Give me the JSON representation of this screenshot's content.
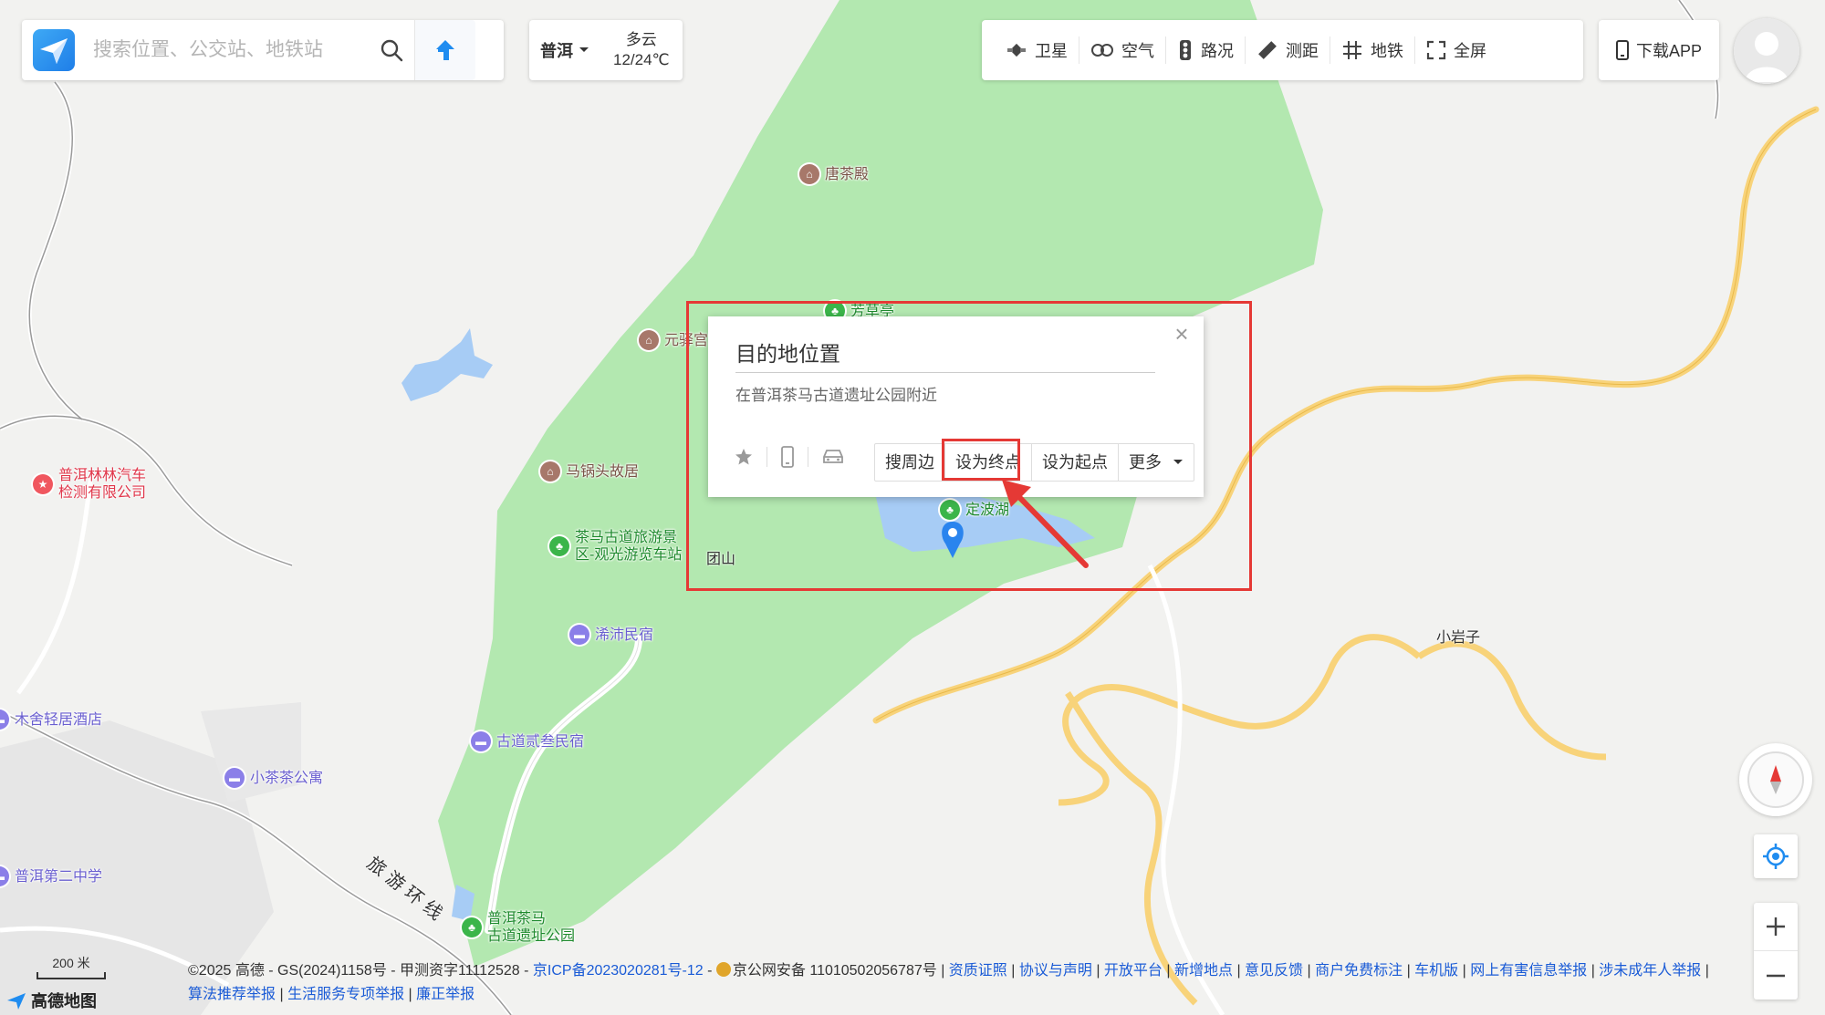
{
  "search": {
    "placeholder": "搜索位置、公交站、地铁站"
  },
  "weather": {
    "city": "普洱",
    "condition": "多云",
    "temp": "12/24℃"
  },
  "toolbar": {
    "items": [
      {
        "label": "卫星",
        "icon": "satellite-icon"
      },
      {
        "label": "空气",
        "icon": "air-icon"
      },
      {
        "label": "路况",
        "icon": "traffic-light-icon"
      },
      {
        "label": "测距",
        "icon": "ruler-icon"
      },
      {
        "label": "地铁",
        "icon": "subway-icon"
      },
      {
        "label": "全屏",
        "icon": "fullscreen-icon"
      }
    ]
  },
  "download": {
    "label": "下载APP"
  },
  "popup": {
    "title": "目的地位置",
    "address": "在普洱茶马古道遗址公园附近",
    "actions": {
      "nearby": "搜周边",
      "set_dest": "设为终点",
      "set_start": "设为起点",
      "more": "更多"
    }
  },
  "map": {
    "pois": {
      "tang": "唐茶殿",
      "fangcao": "芳草亭",
      "yuanyi": "元驿宫",
      "maguo": "马锅头故居",
      "chama_line1": "茶马古道旅游景",
      "chama_line2": "区-观光游览车站",
      "dingbo": "定波湖",
      "tuanshan": "团山",
      "xipei": "浠沛民宿",
      "gudao": "古道贰叁民宿",
      "lin_line1": "普洱林林汽车",
      "lin_line2": "检测有限公司",
      "mushe": "木舍轻居酒店",
      "xiaocha": "小茶茶公寓",
      "school": "普洱第二中学",
      "park_line1": "普洱茶马",
      "park_line2": "古道遗址公园",
      "xiaoyan": "小岩子",
      "road": "旅游环线"
    },
    "scale": "200 米",
    "logo_text": "高德地图"
  },
  "footer": {
    "line1_prefix": "©2025 高德 - GS(2024)1158号 - 甲测资字11112528 - ",
    "icp": "京ICP备2023020281号-12",
    "dash": " - ",
    "police": "京公网安备 11010502056787号",
    "links1": [
      "资质证照",
      "协议与声明",
      "开放平台",
      "新增地点",
      "意见反馈",
      "商户免费标注",
      "车机版",
      "网上有害信息举报",
      "涉未成年人举报"
    ],
    "links2": [
      "算法推荐举报",
      "生活服务专项举报",
      "廉正举报"
    ],
    "sep": " | "
  },
  "colors": {
    "park": "#b3e8b0",
    "water": "#a7ccf5",
    "road_yellow": "#f8d37a",
    "highlight": "#e53935",
    "link": "#1a5bd6"
  }
}
